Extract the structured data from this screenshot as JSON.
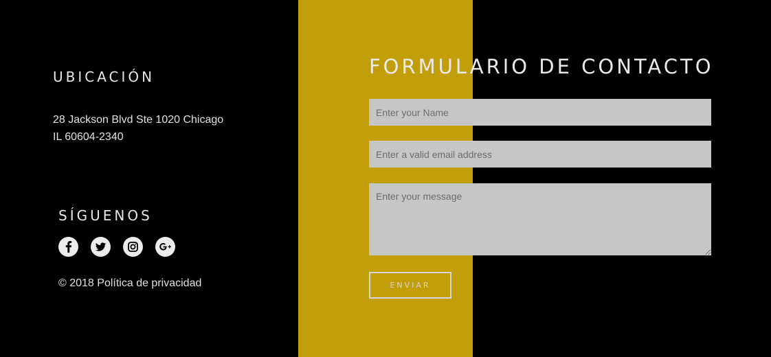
{
  "location": {
    "title": "UBICACIÓN",
    "address_line1": "28 Jackson Blvd Ste 1020 Chicago",
    "address_line2": "IL 60604-2340"
  },
  "follow": {
    "title": "SÍGUENOS",
    "icons": [
      "facebook-icon",
      "twitter-icon",
      "instagram-icon",
      "google-plus-icon"
    ]
  },
  "footer": {
    "copyright": "© 2018 Política de privacidad"
  },
  "contact_form": {
    "title": "FORMULARIO DE CONTACTO",
    "name_placeholder": "Enter your Name",
    "email_placeholder": "Enter a valid email address",
    "message_placeholder": "Enter your message",
    "submit_label": "ENVIAR"
  },
  "colors": {
    "background": "#000000",
    "accent_band": "#c29e0a",
    "field_background": "#c6c6c6",
    "text": "#e6e6e6"
  }
}
